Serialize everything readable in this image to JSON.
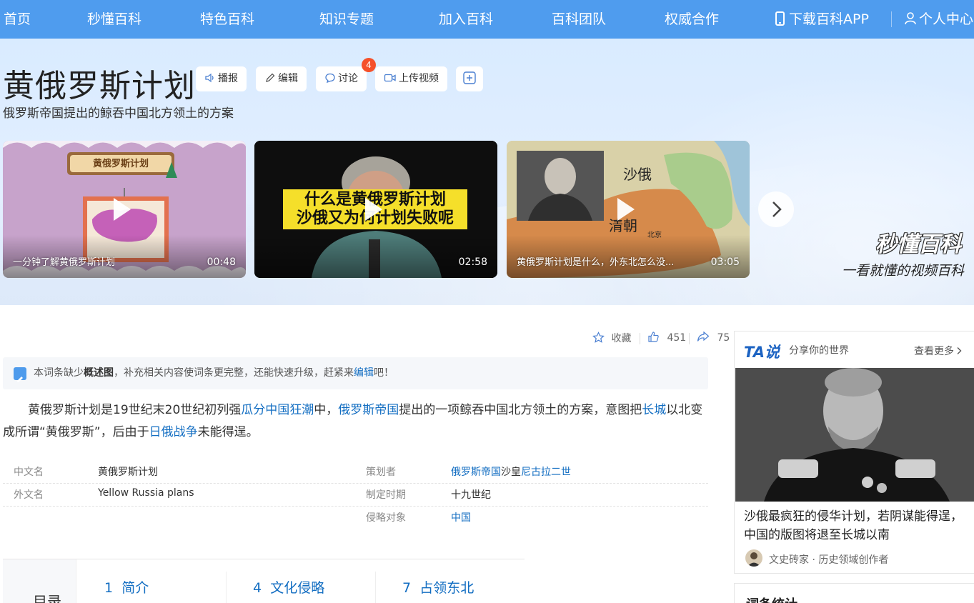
{
  "nav": {
    "items": [
      "首页",
      "秒懂百科",
      "特色百科",
      "知识专题",
      "加入百科",
      "百科团队",
      "权威合作"
    ],
    "app_label": "下载百科APP",
    "user_label": "个人中心"
  },
  "header": {
    "title": "黄俄罗斯计划",
    "subtitle": "俄罗斯帝国提出的鲸吞中国北方领土的方案",
    "tools": {
      "broadcast": "播报",
      "edit": "编辑",
      "discuss": "讨论",
      "discuss_badge": "4",
      "upload_video": "上传视频"
    }
  },
  "videos": [
    {
      "title": "一分钟了解黄俄罗斯计划",
      "duration": "00:48",
      "thumb_text": "黄俄罗斯计划"
    },
    {
      "title": "",
      "duration": "02:58",
      "thumb_text_1": "什么是黄俄罗斯计划",
      "thumb_text_2": "沙俄又为何计划失败呢"
    },
    {
      "title": "黄俄罗斯计划是什么，外东北怎么没...",
      "duration": "03:05",
      "map_label_1": "沙俄",
      "map_label_2": "清朝",
      "map_label_3": "北京"
    }
  ],
  "brand": {
    "logo": "秒懂百科",
    "slogan": "一看就懂的视频百科"
  },
  "actions": {
    "favorite": "收藏",
    "likes": "451",
    "shares": "75"
  },
  "notice": {
    "prefix": "本词条缺少",
    "bold": "概述图",
    "middle": "，补充相关内容使词条更完整，还能快速升级，赶紧来",
    "link": "编辑",
    "suffix": "吧！"
  },
  "summary": {
    "t1": "黄俄罗斯计划是19世纪末20世纪初列强",
    "l1": "瓜分中国狂潮",
    "t2": "中，",
    "l2": "俄罗斯帝国",
    "t3": "提出的一项鲸吞中国北方领土的方案，意图把",
    "l3": "长城",
    "t4": "以北变成所谓“黄俄罗斯”，后由于",
    "l4": "日俄战争",
    "t5": "未能得逞。"
  },
  "info": {
    "cn_name_key": "中文名",
    "cn_name_val": "黄俄罗斯计划",
    "en_name_key": "外文名",
    "en_name_val": "Yellow Russia plans",
    "planner_key": "策划者",
    "planner_link1": "俄罗斯帝国",
    "planner_text": "沙皇",
    "planner_link2": "尼古拉二世",
    "time_key": "制定时期",
    "time_val": "十九世纪",
    "target_key": "侵略对象",
    "target_val": "中国"
  },
  "catalog": {
    "label": "目录",
    "items": [
      {
        "num": "1",
        "label": "简介"
      },
      {
        "num": "4",
        "label": "文化侵略"
      },
      {
        "num": "7",
        "label": "占领东北"
      }
    ]
  },
  "sidebar": {
    "ta_logo": "TA说",
    "ta_slogan": "分享你的世界",
    "ta_more": "查看更多",
    "headline": "沙俄最疯狂的侵华计划，若阴谋能得逞，中国的版图将退至长城以南",
    "author": "文史砖家 · 历史领域创作者",
    "stats_title": "词条统计"
  }
}
